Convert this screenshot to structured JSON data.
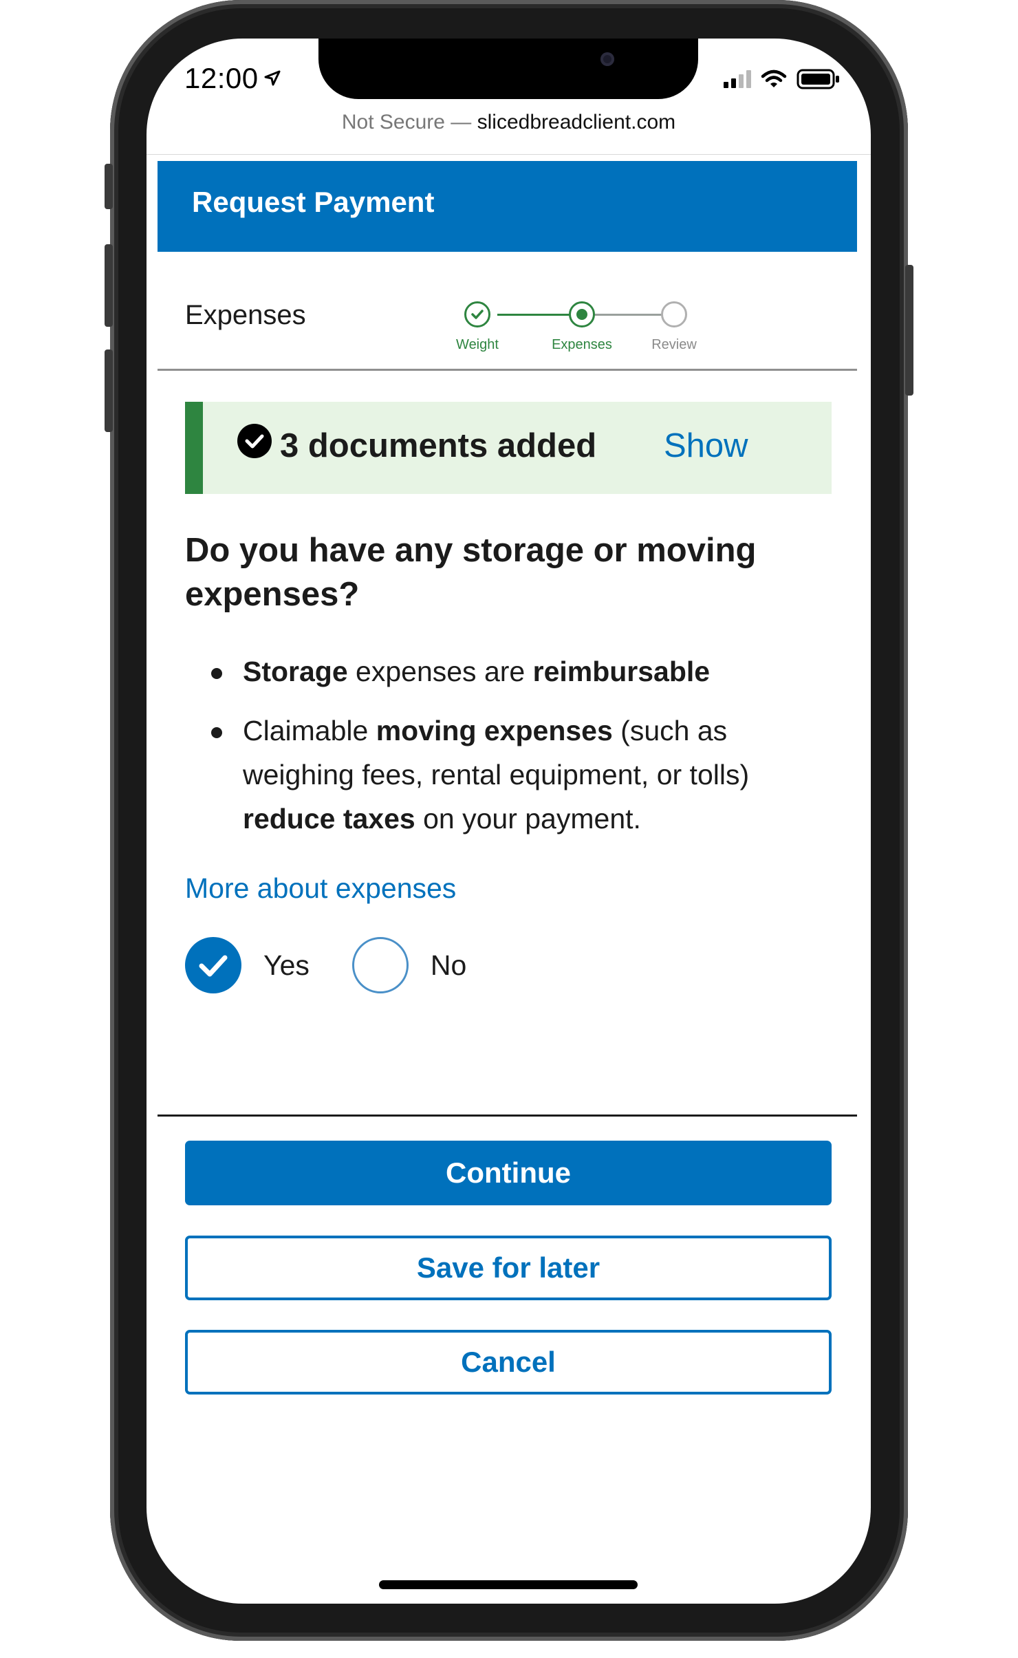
{
  "status_bar": {
    "time": "12:00",
    "icons": [
      "location-arrow-icon",
      "cellular-signal-icon",
      "wifi-icon",
      "battery-icon"
    ]
  },
  "browser": {
    "security_label": "Not Secure",
    "separator": "—",
    "domain": "slicedbreadclient.com"
  },
  "header": {
    "title": "Request Payment",
    "color": "#0071bc"
  },
  "progress": {
    "current_step_title": "Expenses",
    "steps": [
      {
        "label": "Weight",
        "status": "complete"
      },
      {
        "label": "Expenses",
        "status": "current"
      },
      {
        "label": "Review",
        "status": "pending"
      }
    ],
    "complete_color": "#2e8540"
  },
  "alert": {
    "message": "3 documents added",
    "link_label": "Show",
    "icon": "check-circle-icon",
    "color": "#2e8540",
    "background": "#e7f4e4"
  },
  "question": {
    "heading": "Do you have any storage or moving expenses?",
    "bullet_1": {
      "b1": "Storage",
      "t1": " expenses are ",
      "b2": "reimbursable"
    },
    "bullet_2": {
      "t1": "Claimable ",
      "b1": "moving expenses",
      "t2": " (such as weighing fees, rental equipment, or tolls) ",
      "b2": "reduce taxes",
      "t3": " on your payment."
    },
    "more_link": "More about expenses"
  },
  "options": {
    "yes_label": "Yes",
    "no_label": "No",
    "selected": "Yes"
  },
  "actions": {
    "continue_label": "Continue",
    "save_label": "Save for later",
    "cancel_label": "Cancel"
  }
}
